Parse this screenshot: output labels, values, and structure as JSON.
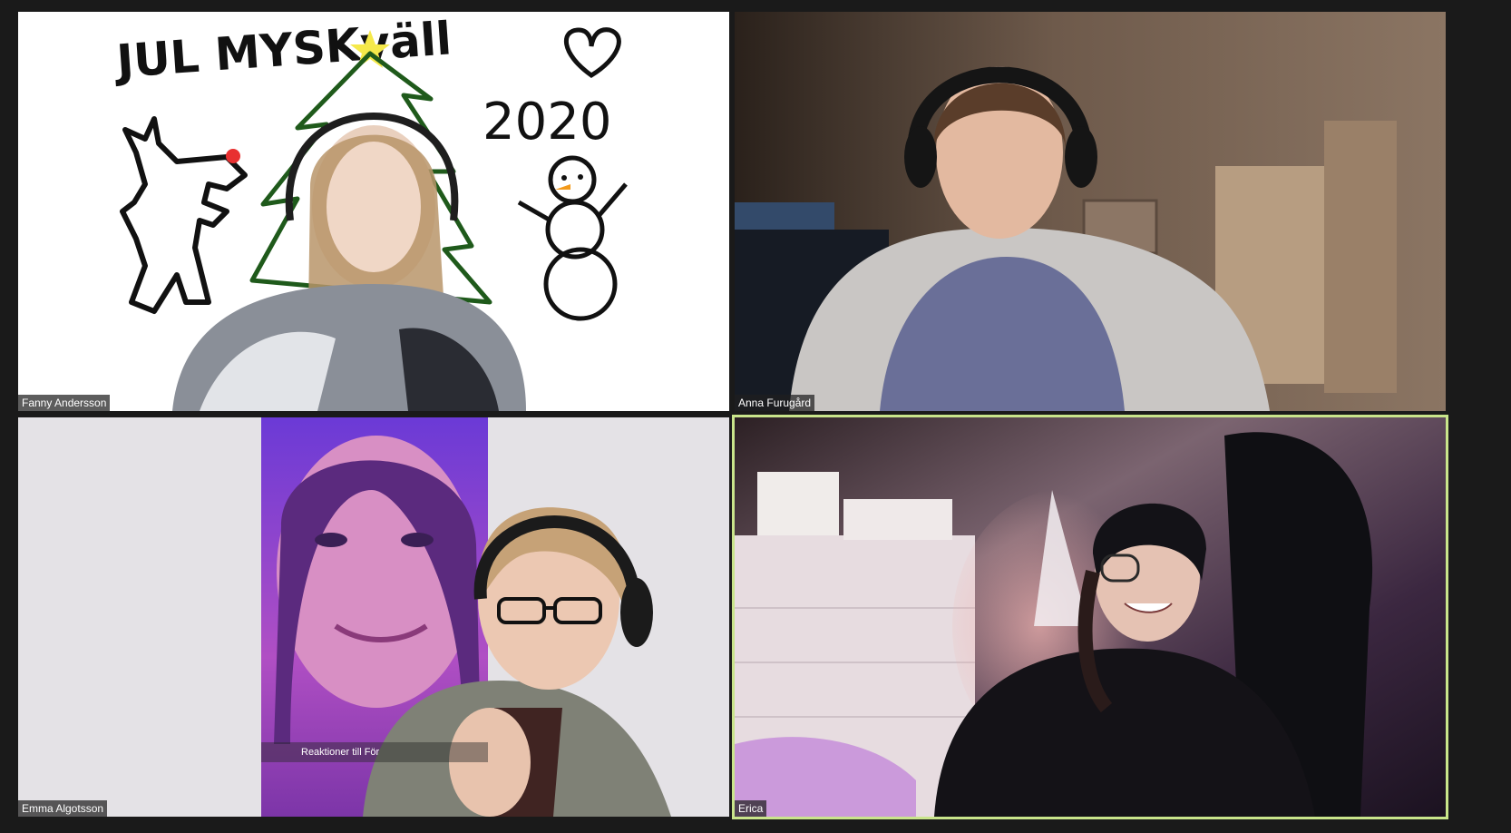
{
  "app": {
    "layout": "gallery-view"
  },
  "tiles": [
    {
      "participant_name": "Fanny Andersson",
      "drawing": {
        "title": "JUL MYSKväll",
        "year": "2020",
        "icons": [
          "heart-icon",
          "reindeer-drawing",
          "christmas-tree-drawing",
          "snowman-drawing"
        ]
      }
    },
    {
      "participant_name": "Anna Furugård"
    },
    {
      "participant_name": "Emma Algotsson",
      "screen_caption": "Reaktioner till För"
    },
    {
      "participant_name": "Erica",
      "active_speaker": true
    }
  ],
  "colors": {
    "active_speaker_border": "#c9e58b",
    "speaker_bar": "#f5ef8a",
    "background": "#1a1a1a"
  }
}
